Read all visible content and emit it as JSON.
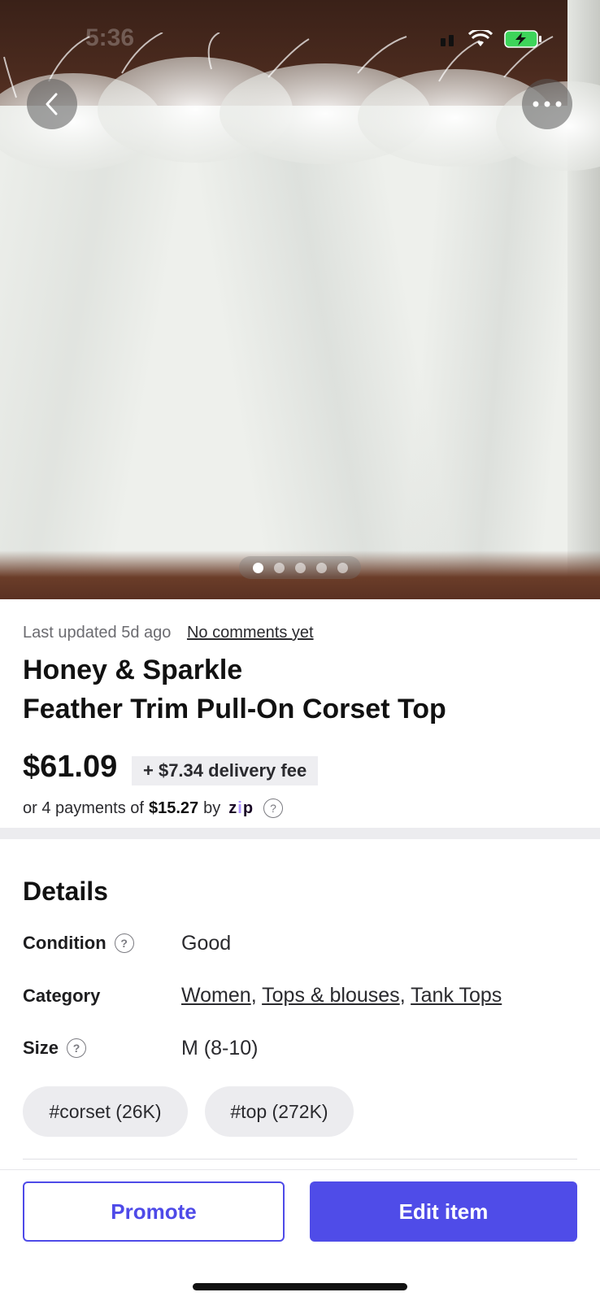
{
  "status_bar": {
    "time": "5:36"
  },
  "gallery": {
    "total": 5,
    "active": 1
  },
  "listing": {
    "last_updated": "Last updated 5d ago",
    "comments_link": "No comments yet",
    "title_line1": "Honey & Sparkle",
    "title_line2": "Feather Trim Pull-On Corset Top",
    "price": "$61.09",
    "delivery_fee": "+ $7.34 delivery fee",
    "installments_prefix": "or 4 payments of",
    "installment_amount": "$15.27",
    "installments_by": "by",
    "pay_provider": "zip"
  },
  "details": {
    "heading": "Details",
    "condition_label": "Condition",
    "condition_value": "Good",
    "category_label": "Category",
    "categories": [
      "Women",
      "Tops & blouses",
      "Tank Tops"
    ],
    "size_label": "Size",
    "size_value": "M (8-10)",
    "tags": [
      "#corset (26K)",
      "#top (272K)"
    ]
  },
  "actions": {
    "promote_label": "Promote",
    "edit_label": "Edit item"
  },
  "colors": {
    "accent": "#4f4ce8",
    "zip_brand": "#aa8fff"
  }
}
